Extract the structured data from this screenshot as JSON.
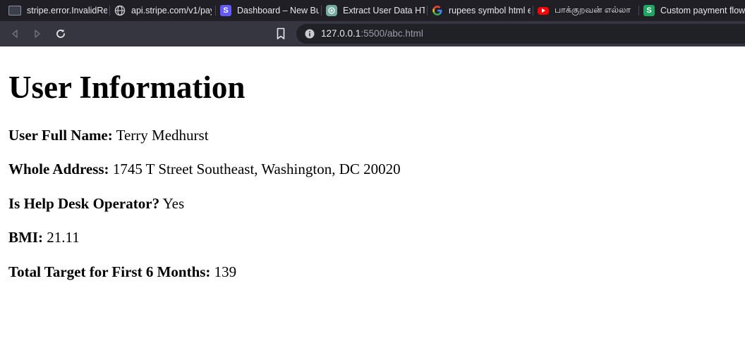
{
  "browser": {
    "tabs": [
      {
        "title": "stripe.error.InvalidReq",
        "icon": "terminal-icon"
      },
      {
        "title": "api.stripe.com/v1/pay",
        "icon": "globe-icon"
      },
      {
        "title": "Dashboard – New Bu",
        "icon": "stripe-icon"
      },
      {
        "title": "Extract User Data HTN",
        "icon": "chatgpt-icon"
      },
      {
        "title": "rupees symbol html e",
        "icon": "google-icon"
      },
      {
        "title": "பாக்குறவன் எல்லா",
        "icon": "youtube-icon"
      },
      {
        "title": "Custom payment flow",
        "icon": "s-green-icon"
      }
    ],
    "url_host": "127.0.0.1",
    "url_rest": ":5500/abc.html"
  },
  "page": {
    "heading": "User Information",
    "fields": [
      {
        "label": "User Full Name:",
        "value": "Terry Medhurst"
      },
      {
        "label": "Whole Address:",
        "value": "1745 T Street Southeast, Washington, DC 20020"
      },
      {
        "label": "Is Help Desk Operator?",
        "value": "Yes"
      },
      {
        "label": "BMI:",
        "value": "21.11"
      },
      {
        "label": "Total Target for First 6 Months:",
        "value": "139"
      }
    ]
  },
  "colors": {
    "tabbar_bg": "#1f1f25",
    "toolbar_bg": "#35363f",
    "omnibox_bg": "#202127",
    "page_bg": "#ffffff"
  }
}
